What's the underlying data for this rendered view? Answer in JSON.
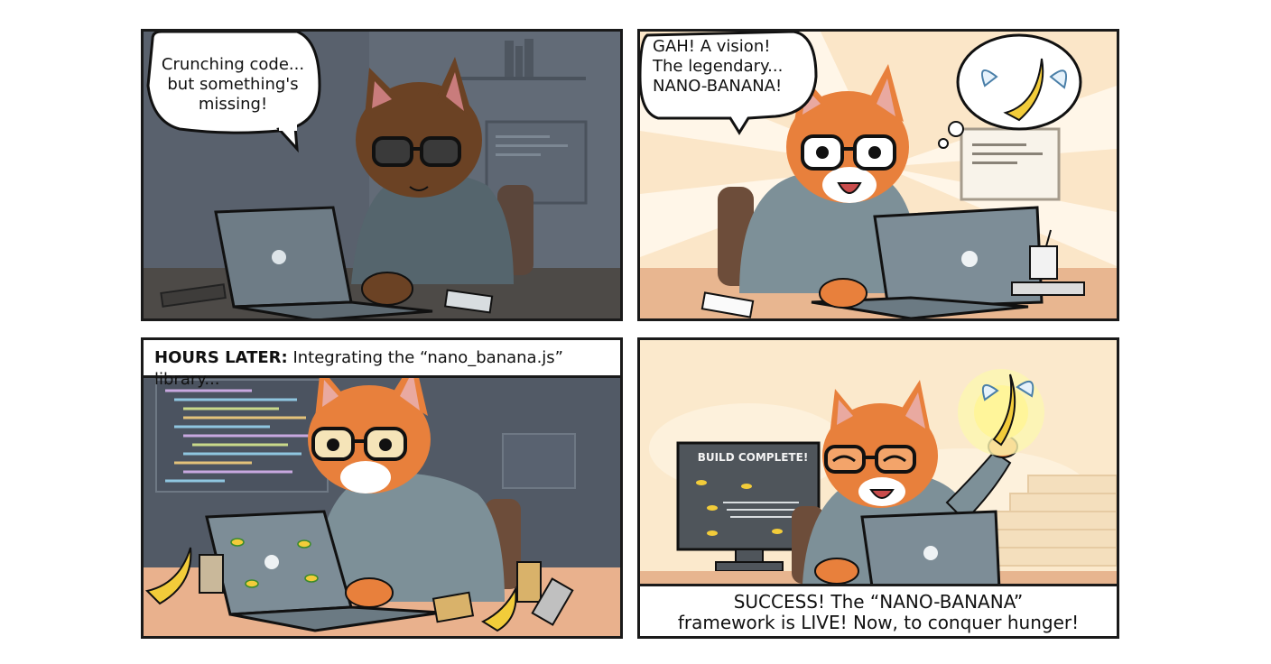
{
  "comic": {
    "panel1": {
      "speech": "Crunching code... but something's missing!"
    },
    "panel2": {
      "speech_line1": "GAH! A vision!",
      "speech_line2": "The legendary...",
      "speech_line3": "NANO-BANANA!"
    },
    "panel3": {
      "caption_bold": "HOURS LATER:",
      "caption_rest": "Integrating the “nano_banana.js” library..."
    },
    "panel4": {
      "monitor_text": "BUILD COMPLETE!",
      "caption_line1": "SUCCESS! The “NANO-BANANA”",
      "caption_line2": "framework is LIVE! Now, to conquer hunger!"
    }
  },
  "colors": {
    "outline": "#1a1a1a",
    "cat_orange": "#e8803c",
    "cat_dark": "#7a4a28",
    "hoodie": "#6f8a96",
    "laptop": "#7d8d97",
    "banana": "#f2cc3a",
    "night_bg": "#5a6370",
    "warm_bg": "#fbe6c8"
  }
}
